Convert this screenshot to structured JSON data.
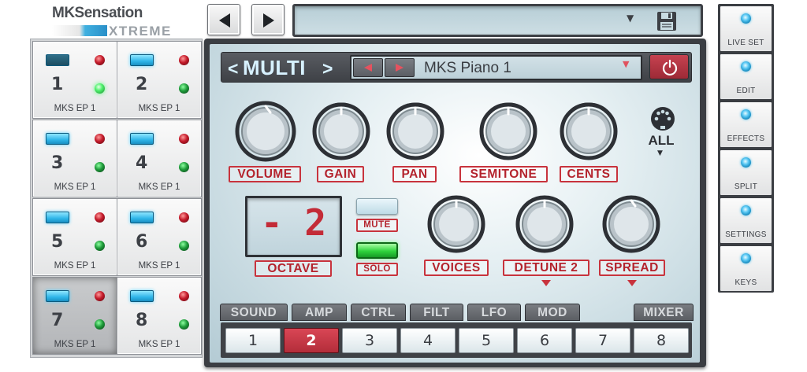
{
  "logo": {
    "top": "MKSensation",
    "bottom": "XTREME"
  },
  "parts": [
    {
      "number": "1",
      "name": "MKS EP 1",
      "led_on": false,
      "green_on": true,
      "selected": false
    },
    {
      "number": "2",
      "name": "MKS EP 1",
      "led_on": true,
      "green_on": false,
      "selected": false
    },
    {
      "number": "3",
      "name": "MKS EP 1",
      "led_on": true,
      "green_on": false,
      "selected": false
    },
    {
      "number": "4",
      "name": "MKS EP 1",
      "led_on": true,
      "green_on": false,
      "selected": false
    },
    {
      "number": "5",
      "name": "MKS EP 1",
      "led_on": true,
      "green_on": false,
      "selected": false
    },
    {
      "number": "6",
      "name": "MKS EP 1",
      "led_on": true,
      "green_on": false,
      "selected": false
    },
    {
      "number": "7",
      "name": "MKS EP 1",
      "led_on": true,
      "green_on": false,
      "selected": true
    },
    {
      "number": "8",
      "name": "MKS EP 1",
      "led_on": true,
      "green_on": false,
      "selected": false
    }
  ],
  "nav": {
    "prev_icon": "triangle-left-icon",
    "next_icon": "triangle-right-icon"
  },
  "top_display": {
    "dropdown_icon": "chevron-down-icon",
    "save_icon": "floppy-disk-icon"
  },
  "header": {
    "prev": "<",
    "mode": "MULTI",
    "next": ">",
    "preset_name": "MKS Piano 1",
    "power_icon": "power-icon"
  },
  "knobs": {
    "volume": "VOLUME",
    "gain": "GAIN",
    "pan": "PAN",
    "semitone": "SEMITONE",
    "cents": "CENTS",
    "voices": "VOICES",
    "detune": "DETUNE 2",
    "spread": "SPREAD"
  },
  "channel": {
    "icon": "midi-din-icon",
    "value": "ALL"
  },
  "octave": {
    "label": "OCTAVE",
    "value": "- 2"
  },
  "buttons": {
    "mute": "MUTE",
    "solo": "SOLO",
    "mute_on": false,
    "solo_on": true
  },
  "tabs": [
    "SOUND",
    "AMP",
    "CTRL",
    "FILT",
    "LFO",
    "MOD",
    "MIXER"
  ],
  "part_buttons": [
    "1",
    "2",
    "3",
    "4",
    "5",
    "6",
    "7",
    "8"
  ],
  "active_part": "2",
  "right_menu": [
    "LIVE SET",
    "EDIT",
    "EFFECTS",
    "SPLIT",
    "SETTINGS",
    "KEYS"
  ],
  "colors": {
    "accent_red": "#c8333d",
    "led_blue": "#2fb5e8",
    "led_green": "#2fd33c",
    "panel_dark": "#3b3e43"
  }
}
